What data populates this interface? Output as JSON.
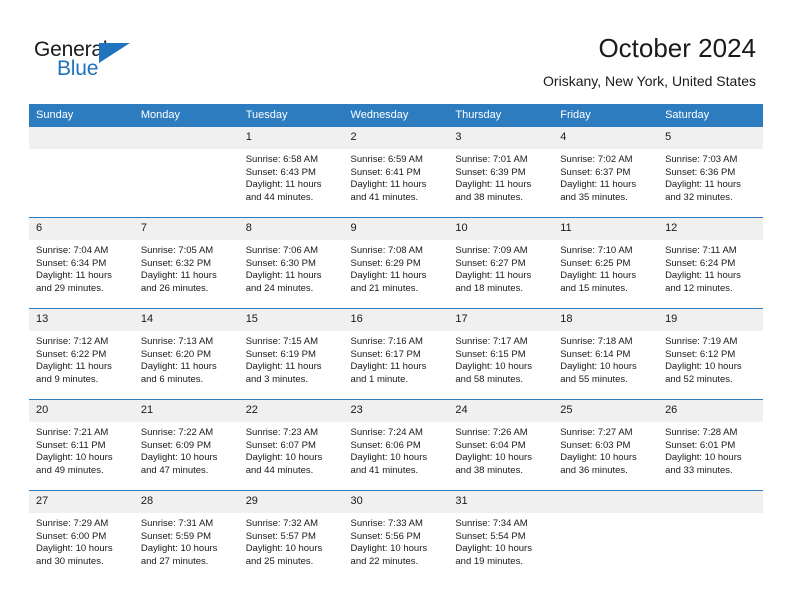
{
  "brand": {
    "name_part1": "General",
    "name_part2": "Blue",
    "triangle_color": "#1f74bd"
  },
  "header": {
    "title": "October 2024",
    "subtitle": "Oriskany, New York, United States",
    "header_bg": "#2e7cc0",
    "daynum_bg": "#f0f0f0"
  },
  "weekdays": [
    "Sunday",
    "Monday",
    "Tuesday",
    "Wednesday",
    "Thursday",
    "Friday",
    "Saturday"
  ],
  "labels": {
    "sunrise_prefix": "Sunrise: ",
    "sunset_prefix": "Sunset: ",
    "daylight_prefix": "Daylight: "
  },
  "weeks": [
    [
      {
        "day": "",
        "sunrise": "",
        "sunset": "",
        "daylight": ""
      },
      {
        "day": "",
        "sunrise": "",
        "sunset": "",
        "daylight": ""
      },
      {
        "day": "1",
        "sunrise": "Sunrise: 6:58 AM",
        "sunset": "Sunset: 6:43 PM",
        "daylight": "Daylight: 11 hours and 44 minutes."
      },
      {
        "day": "2",
        "sunrise": "Sunrise: 6:59 AM",
        "sunset": "Sunset: 6:41 PM",
        "daylight": "Daylight: 11 hours and 41 minutes."
      },
      {
        "day": "3",
        "sunrise": "Sunrise: 7:01 AM",
        "sunset": "Sunset: 6:39 PM",
        "daylight": "Daylight: 11 hours and 38 minutes."
      },
      {
        "day": "4",
        "sunrise": "Sunrise: 7:02 AM",
        "sunset": "Sunset: 6:37 PM",
        "daylight": "Daylight: 11 hours and 35 minutes."
      },
      {
        "day": "5",
        "sunrise": "Sunrise: 7:03 AM",
        "sunset": "Sunset: 6:36 PM",
        "daylight": "Daylight: 11 hours and 32 minutes."
      }
    ],
    [
      {
        "day": "6",
        "sunrise": "Sunrise: 7:04 AM",
        "sunset": "Sunset: 6:34 PM",
        "daylight": "Daylight: 11 hours and 29 minutes."
      },
      {
        "day": "7",
        "sunrise": "Sunrise: 7:05 AM",
        "sunset": "Sunset: 6:32 PM",
        "daylight": "Daylight: 11 hours and 26 minutes."
      },
      {
        "day": "8",
        "sunrise": "Sunrise: 7:06 AM",
        "sunset": "Sunset: 6:30 PM",
        "daylight": "Daylight: 11 hours and 24 minutes."
      },
      {
        "day": "9",
        "sunrise": "Sunrise: 7:08 AM",
        "sunset": "Sunset: 6:29 PM",
        "daylight": "Daylight: 11 hours and 21 minutes."
      },
      {
        "day": "10",
        "sunrise": "Sunrise: 7:09 AM",
        "sunset": "Sunset: 6:27 PM",
        "daylight": "Daylight: 11 hours and 18 minutes."
      },
      {
        "day": "11",
        "sunrise": "Sunrise: 7:10 AM",
        "sunset": "Sunset: 6:25 PM",
        "daylight": "Daylight: 11 hours and 15 minutes."
      },
      {
        "day": "12",
        "sunrise": "Sunrise: 7:11 AM",
        "sunset": "Sunset: 6:24 PM",
        "daylight": "Daylight: 11 hours and 12 minutes."
      }
    ],
    [
      {
        "day": "13",
        "sunrise": "Sunrise: 7:12 AM",
        "sunset": "Sunset: 6:22 PM",
        "daylight": "Daylight: 11 hours and 9 minutes."
      },
      {
        "day": "14",
        "sunrise": "Sunrise: 7:13 AM",
        "sunset": "Sunset: 6:20 PM",
        "daylight": "Daylight: 11 hours and 6 minutes."
      },
      {
        "day": "15",
        "sunrise": "Sunrise: 7:15 AM",
        "sunset": "Sunset: 6:19 PM",
        "daylight": "Daylight: 11 hours and 3 minutes."
      },
      {
        "day": "16",
        "sunrise": "Sunrise: 7:16 AM",
        "sunset": "Sunset: 6:17 PM",
        "daylight": "Daylight: 11 hours and 1 minute."
      },
      {
        "day": "17",
        "sunrise": "Sunrise: 7:17 AM",
        "sunset": "Sunset: 6:15 PM",
        "daylight": "Daylight: 10 hours and 58 minutes."
      },
      {
        "day": "18",
        "sunrise": "Sunrise: 7:18 AM",
        "sunset": "Sunset: 6:14 PM",
        "daylight": "Daylight: 10 hours and 55 minutes."
      },
      {
        "day": "19",
        "sunrise": "Sunrise: 7:19 AM",
        "sunset": "Sunset: 6:12 PM",
        "daylight": "Daylight: 10 hours and 52 minutes."
      }
    ],
    [
      {
        "day": "20",
        "sunrise": "Sunrise: 7:21 AM",
        "sunset": "Sunset: 6:11 PM",
        "daylight": "Daylight: 10 hours and 49 minutes."
      },
      {
        "day": "21",
        "sunrise": "Sunrise: 7:22 AM",
        "sunset": "Sunset: 6:09 PM",
        "daylight": "Daylight: 10 hours and 47 minutes."
      },
      {
        "day": "22",
        "sunrise": "Sunrise: 7:23 AM",
        "sunset": "Sunset: 6:07 PM",
        "daylight": "Daylight: 10 hours and 44 minutes."
      },
      {
        "day": "23",
        "sunrise": "Sunrise: 7:24 AM",
        "sunset": "Sunset: 6:06 PM",
        "daylight": "Daylight: 10 hours and 41 minutes."
      },
      {
        "day": "24",
        "sunrise": "Sunrise: 7:26 AM",
        "sunset": "Sunset: 6:04 PM",
        "daylight": "Daylight: 10 hours and 38 minutes."
      },
      {
        "day": "25",
        "sunrise": "Sunrise: 7:27 AM",
        "sunset": "Sunset: 6:03 PM",
        "daylight": "Daylight: 10 hours and 36 minutes."
      },
      {
        "day": "26",
        "sunrise": "Sunrise: 7:28 AM",
        "sunset": "Sunset: 6:01 PM",
        "daylight": "Daylight: 10 hours and 33 minutes."
      }
    ],
    [
      {
        "day": "27",
        "sunrise": "Sunrise: 7:29 AM",
        "sunset": "Sunset: 6:00 PM",
        "daylight": "Daylight: 10 hours and 30 minutes."
      },
      {
        "day": "28",
        "sunrise": "Sunrise: 7:31 AM",
        "sunset": "Sunset: 5:59 PM",
        "daylight": "Daylight: 10 hours and 27 minutes."
      },
      {
        "day": "29",
        "sunrise": "Sunrise: 7:32 AM",
        "sunset": "Sunset: 5:57 PM",
        "daylight": "Daylight: 10 hours and 25 minutes."
      },
      {
        "day": "30",
        "sunrise": "Sunrise: 7:33 AM",
        "sunset": "Sunset: 5:56 PM",
        "daylight": "Daylight: 10 hours and 22 minutes."
      },
      {
        "day": "31",
        "sunrise": "Sunrise: 7:34 AM",
        "sunset": "Sunset: 5:54 PM",
        "daylight": "Daylight: 10 hours and 19 minutes."
      },
      {
        "day": "",
        "sunrise": "",
        "sunset": "",
        "daylight": ""
      },
      {
        "day": "",
        "sunrise": "",
        "sunset": "",
        "daylight": ""
      }
    ]
  ]
}
